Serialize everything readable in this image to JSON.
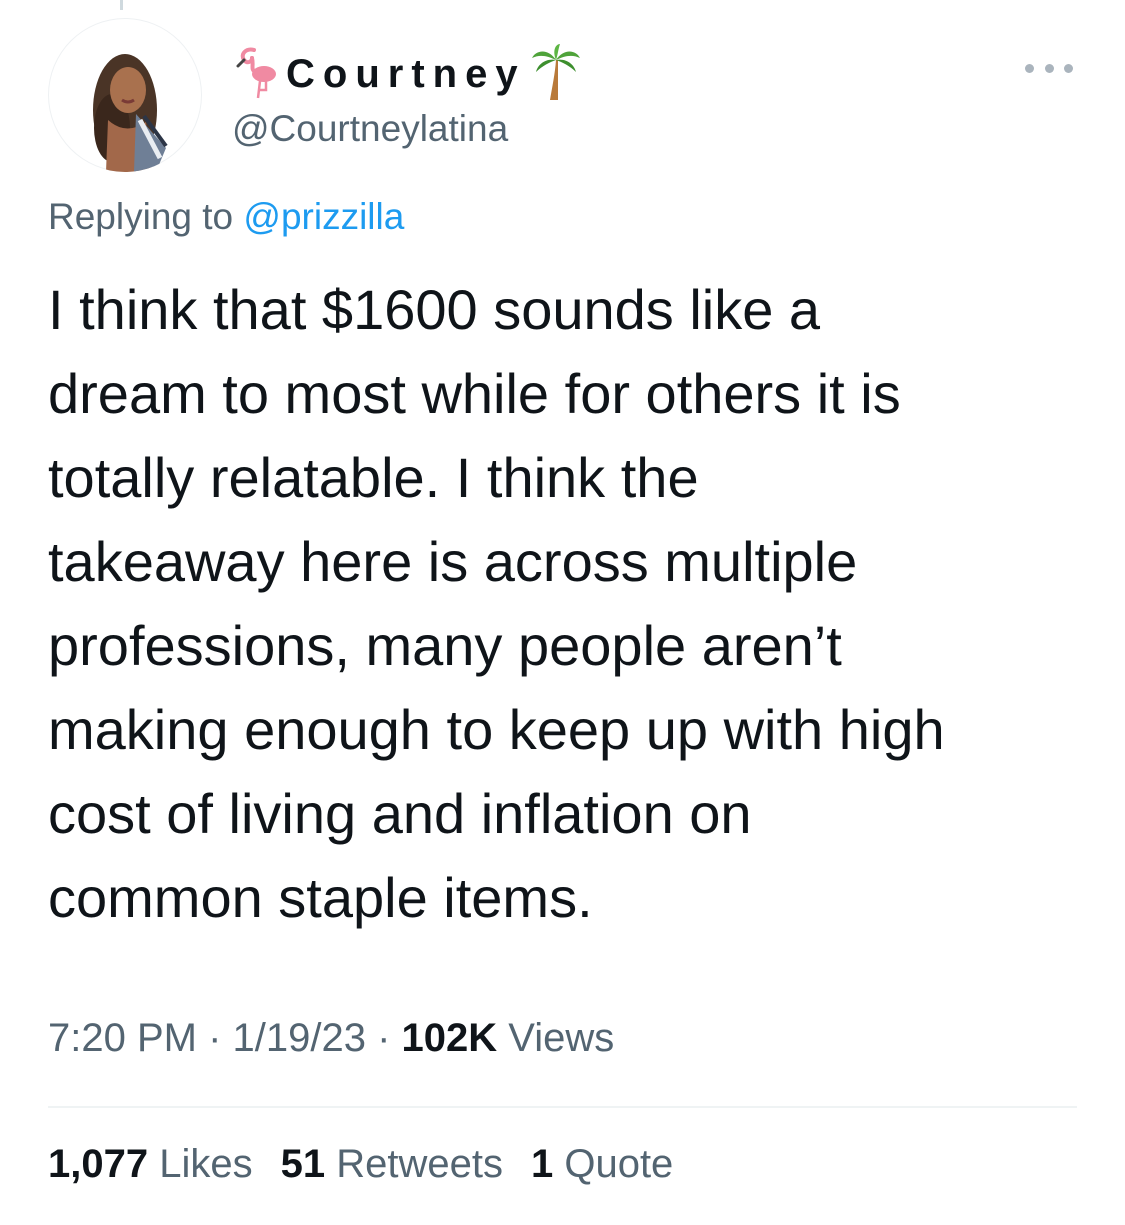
{
  "author": {
    "display_name": "Courtney",
    "handle": "@Courtneylatina",
    "name_prefix_icon": "flamingo-icon",
    "name_suffix_icon": "palm-tree-icon",
    "avatar": "avatar-photo"
  },
  "reply": {
    "prefix": "Replying to ",
    "mention": "@prizzilla"
  },
  "tweet": {
    "text": "I think that $1600 sounds like a\ndream to most while for others it is\ntotally relatable. I think the\ntakeaway here is across multiple\nprofessions, many people aren’t\nmaking enough to keep up with high\ncost of living and inflation on\ncommon staple items."
  },
  "meta": {
    "time": "7:20 PM",
    "sep1": " · ",
    "date": "1/19/23",
    "sep2": " · ",
    "views_count": "102K",
    "views_label": " Views"
  },
  "stats": {
    "likes_count": "1,077",
    "likes_label": " Likes",
    "retweets_count": "51",
    "retweets_label": " Retweets",
    "quotes_count": "1",
    "quotes_label": " Quote"
  },
  "colors": {
    "text": "#0f1419",
    "secondary": "#536471",
    "link": "#1d9bf0",
    "divider": "#eff3f4"
  }
}
